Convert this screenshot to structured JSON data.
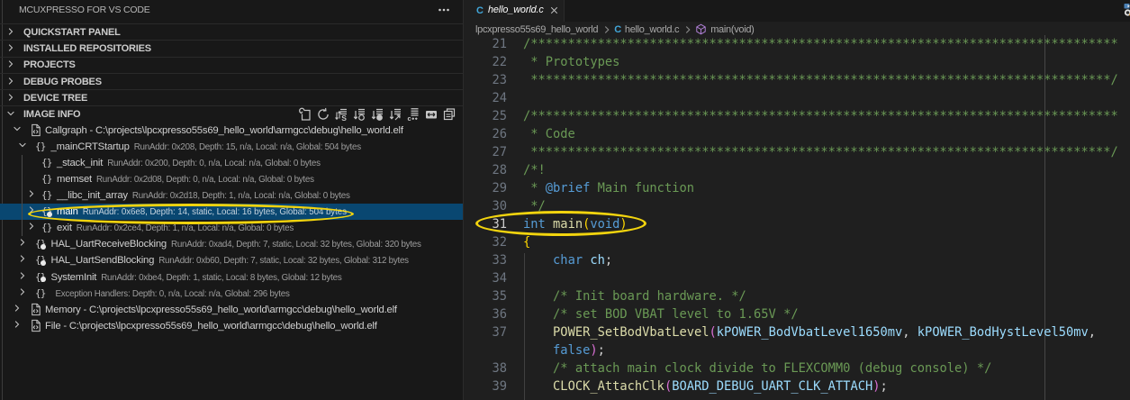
{
  "colors": {
    "sidebar_bg": "#181818",
    "editor_bg": "#1f1f1f",
    "selection_bg": "#094771",
    "annotation_yellow": "#f2d40e",
    "comment": "#6a9955",
    "keyword": "#569cd6",
    "function": "#dcdcaa",
    "variable": "#9cdcfe",
    "bracket_gold": "#ffd700",
    "bracket_pink": "#da70d6",
    "c_icon_blue": "#41a6d9",
    "method_icon_purple": "#b180d7"
  },
  "sidebar": {
    "title": "MCUXPRESSO FOR VS CODE",
    "more_actions_icon": "ellipsis",
    "sections": [
      {
        "label": "QUICKSTART PANEL",
        "expanded": false
      },
      {
        "label": "INSTALLED REPOSITORIES",
        "expanded": false
      },
      {
        "label": "PROJECTS",
        "expanded": false
      },
      {
        "label": "DEBUG PROBES",
        "expanded": false
      },
      {
        "label": "DEVICE TREE",
        "expanded": false
      },
      {
        "label": "IMAGE INFO",
        "expanded": true,
        "toolbar": [
          "export-report",
          "refresh",
          "sort-size",
          "show-circle-outline",
          "show-circle-filled",
          "goto-symbol",
          "filter-cpp",
          "swap-box",
          "copy-list"
        ]
      }
    ],
    "tree": [
      {
        "level": 0,
        "twistie": "expanded",
        "icon": "file-code",
        "label": "Callgraph - C:\\projects\\lpcxpresso55s69_hello_world\\armgcc\\debug\\hello_world.elf",
        "description": "",
        "selected": false
      },
      {
        "level": 1,
        "twistie": "expanded",
        "icon": "namespace",
        "label": "_mainCRTStartup",
        "description": "RunAddr: 0x208, Depth: 15, n/a, Local: n/a, Global: 504 bytes",
        "selected": false
      },
      {
        "level": 2,
        "twistie": "none",
        "icon": "namespace",
        "label": "_stack_init",
        "description": "RunAddr: 0x200, Depth: 0, n/a, Local: n/a, Global: 0 bytes",
        "selected": false
      },
      {
        "level": 2,
        "twistie": "none",
        "icon": "namespace",
        "label": "memset",
        "description": "RunAddr: 0x2d08, Depth: 0, n/a, Local: n/a, Global: 0 bytes",
        "selected": false
      },
      {
        "level": 2,
        "twistie": "collapsed",
        "icon": "namespace",
        "label": "__libc_init_array",
        "description": "RunAddr: 0x2d18, Depth: 1, n/a, Local: n/a, Global: 0 bytes",
        "selected": false
      },
      {
        "level": 2,
        "twistie": "collapsed",
        "icon": "namespace-static",
        "label": "main",
        "description": "RunAddr: 0x6e8, Depth: 14, static, Local: 16 bytes, Global: 504 bytes",
        "selected": true
      },
      {
        "level": 2,
        "twistie": "collapsed",
        "icon": "namespace",
        "label": "exit",
        "description": "RunAddr: 0x2ce4, Depth: 1, n/a, Local: n/a, Global: 0 bytes",
        "selected": false
      },
      {
        "level": 1,
        "twistie": "collapsed",
        "icon": "namespace-static",
        "label": "HAL_UartReceiveBlocking",
        "description": "RunAddr: 0xad4, Depth: 7, static, Local: 32 bytes, Global: 320 bytes",
        "selected": false
      },
      {
        "level": 1,
        "twistie": "collapsed",
        "icon": "namespace-static",
        "label": "HAL_UartSendBlocking",
        "description": "RunAddr: 0xb60, Depth: 7, static, Local: 32 bytes, Global: 312 bytes",
        "selected": false
      },
      {
        "level": 1,
        "twistie": "collapsed",
        "icon": "namespace-static",
        "label": "SystemInit",
        "description": "RunAddr: 0xbe4, Depth: 1, static, Local: 8 bytes, Global: 12 bytes",
        "selected": false
      },
      {
        "level": 1,
        "twistie": "collapsed",
        "icon": "namespace",
        "label": "",
        "description": "Exception Handlers: Depth: 0, n/a, Local: n/a, Global: 296 bytes",
        "selected": false
      },
      {
        "level": 0,
        "twistie": "collapsed",
        "icon": "file-code",
        "label": "Memory - C:\\projects\\lpcxpresso55s69_hello_world\\armgcc\\debug\\hello_world.elf",
        "description": "",
        "selected": false
      },
      {
        "level": 0,
        "twistie": "collapsed",
        "icon": "file-code",
        "label": "File - C:\\projects\\lpcxpresso55s69_hello_world\\armgcc\\debug\\hello_world.elf",
        "description": "",
        "selected": false
      }
    ]
  },
  "editor": {
    "tab": {
      "language_icon": "c",
      "language_icon_text": "C",
      "title": "hello_world.c",
      "close_icon": "close"
    },
    "corner_icon": "debug-partial",
    "breadcrumb": [
      {
        "icon": "",
        "label": "lpcxpresso55s69_hello_world"
      },
      {
        "icon": "c",
        "label": "hello_world.c"
      },
      {
        "icon": "symbol-method",
        "label": "main(void)"
      }
    ],
    "code": {
      "lines": [
        {
          "num": "21",
          "tokens": [
            [
              "c",
              "/*******************************************************************************"
            ]
          ]
        },
        {
          "num": "22",
          "tokens": [
            [
              "c",
              " * Prototypes"
            ]
          ]
        },
        {
          "num": "23",
          "tokens": [
            [
              "c",
              " ******************************************************************************/"
            ]
          ]
        },
        {
          "num": "24",
          "tokens": []
        },
        {
          "num": "25",
          "tokens": [
            [
              "c",
              "/*******************************************************************************"
            ]
          ]
        },
        {
          "num": "26",
          "tokens": [
            [
              "c",
              " * Code"
            ]
          ]
        },
        {
          "num": "27",
          "tokens": [
            [
              "c",
              " ******************************************************************************/"
            ]
          ]
        },
        {
          "num": "28",
          "tokens": [
            [
              "c",
              "/*!"
            ]
          ]
        },
        {
          "num": "29",
          "tokens": [
            [
              "c",
              " * "
            ],
            [
              "k",
              "@brief"
            ],
            [
              "c",
              " Main function"
            ]
          ]
        },
        {
          "num": "30",
          "tokens": [
            [
              "c",
              " */"
            ]
          ]
        },
        {
          "num": "31",
          "active": true,
          "tokens": [
            [
              "k",
              "int"
            ],
            [
              "p",
              " "
            ],
            [
              "f",
              "main"
            ],
            [
              "b1",
              "("
            ],
            [
              "k",
              "void"
            ],
            [
              "b1",
              ")"
            ]
          ]
        },
        {
          "num": "32",
          "tokens": [
            [
              "b1",
              "{"
            ]
          ]
        },
        {
          "num": "33",
          "tokens": [
            [
              "p",
              "    "
            ],
            [
              "k",
              "char"
            ],
            [
              "p",
              " "
            ],
            [
              "v",
              "ch"
            ],
            [
              "p",
              ";"
            ]
          ]
        },
        {
          "num": "34",
          "tokens": []
        },
        {
          "num": "35",
          "tokens": [
            [
              "c",
              "    /* Init board hardware. */"
            ]
          ]
        },
        {
          "num": "36",
          "tokens": [
            [
              "c",
              "    /* set BOD VBAT level to 1.65V */"
            ]
          ]
        },
        {
          "num": "37",
          "tokens": [
            [
              "p",
              "    "
            ],
            [
              "f",
              "POWER_SetBodVbatLevel"
            ],
            [
              "b2",
              "("
            ],
            [
              "v",
              "kPOWER_BodVbatLevel1650mv"
            ],
            [
              "p",
              ", "
            ],
            [
              "v",
              "kPOWER_BodHystLevel50mv"
            ],
            [
              "p",
              ","
            ]
          ]
        },
        {
          "num": "",
          "tokens": [
            [
              "p",
              "    "
            ],
            [
              "k",
              "false"
            ],
            [
              "b2",
              ")"
            ],
            [
              "p",
              ";"
            ]
          ]
        },
        {
          "num": "38",
          "tokens": [
            [
              "c",
              "    /* attach main clock divide to FLEXCOMM0 (debug console) */"
            ]
          ]
        },
        {
          "num": "39",
          "tokens": [
            [
              "p",
              "    "
            ],
            [
              "f",
              "CLOCK_AttachClk"
            ],
            [
              "b2",
              "("
            ],
            [
              "v",
              "BOARD_DEBUG_UART_CLK_ATTACH"
            ],
            [
              "b2",
              ")"
            ],
            [
              "p",
              ";"
            ]
          ]
        }
      ]
    }
  },
  "annotations": [
    {
      "shape": "ellipse",
      "target": "tree-row-main"
    },
    {
      "shape": "ellipse",
      "target": "code-line-31"
    }
  ]
}
